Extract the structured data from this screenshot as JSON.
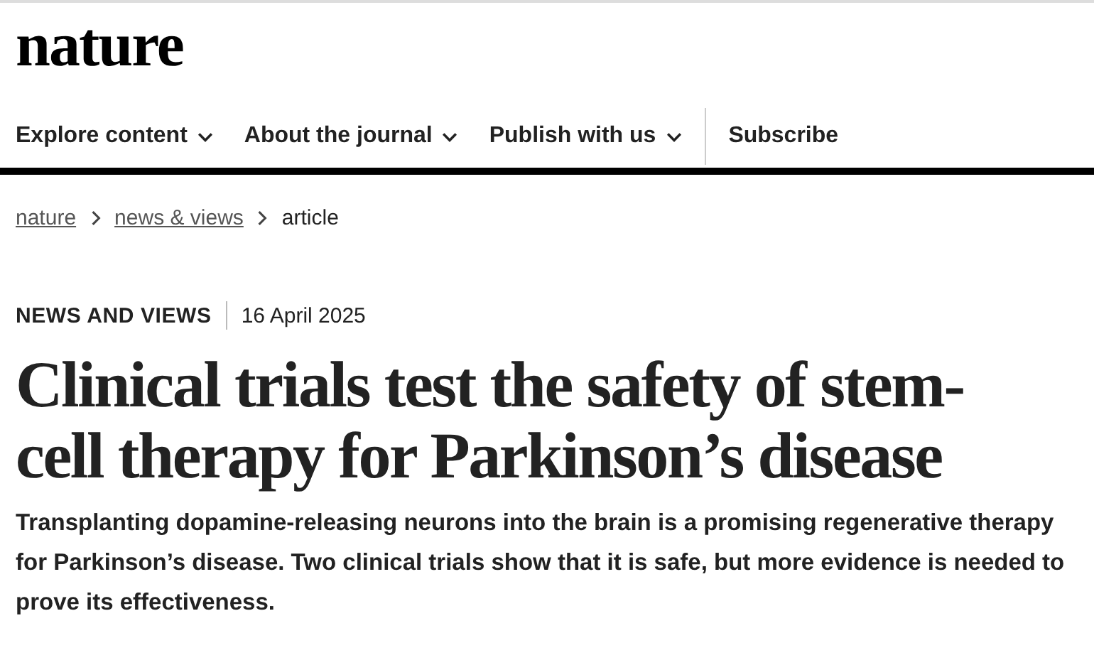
{
  "logo": "nature",
  "nav": [
    {
      "label": "Explore content",
      "dropdown": true
    },
    {
      "label": "About the journal",
      "dropdown": true
    },
    {
      "label": "Publish with us",
      "dropdown": true
    },
    {
      "label": "Subscribe",
      "dropdown": false
    }
  ],
  "breadcrumb": [
    {
      "label": "nature",
      "kind": "link"
    },
    {
      "label": "news & views",
      "kind": "link"
    },
    {
      "label": "article",
      "kind": "current"
    }
  ],
  "article": {
    "type": "NEWS AND VIEWS",
    "date": "16 April 2025",
    "title": "Clinical trials test the safety of stem-cell therapy for Parkinson’s disease",
    "standfirst": "Transplanting dopamine-releasing neurons into the brain is a promising regenerative therapy for Parkinson’s disease. Two clinical trials show that it is safe, but more evidence is needed to prove its effectiveness."
  }
}
